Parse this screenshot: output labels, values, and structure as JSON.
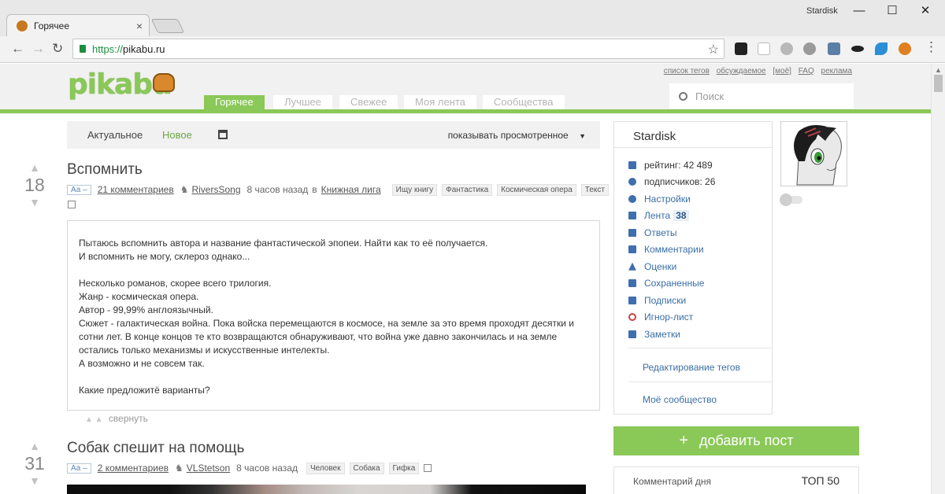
{
  "browser": {
    "tab_title": "Горячее",
    "tab_close": "×",
    "window_user": "Stardisk",
    "win_minimize": "—",
    "win_maximize": "☐",
    "win_close": "✕",
    "url_protocol": "https://",
    "url_host": "pikabu.ru",
    "back": "←",
    "forward": "→",
    "reload": "↻",
    "bookmark_star": "☆"
  },
  "header": {
    "logo": "pikabu",
    "toplinks": [
      "список тегов",
      "обсуждаемое",
      "[моё]",
      "FAQ",
      "реклама"
    ],
    "nav": [
      "Горячее",
      "Лучшее",
      "Свежее",
      "Моя лента",
      "Сообщества"
    ],
    "search_placeholder": "Поиск"
  },
  "filters": {
    "actual": "Актуальное",
    "new": "Новое",
    "show_viewed": "показывать просмотренное",
    "caret": "▼"
  },
  "posts": [
    {
      "rating": "18",
      "title": "Вспомнить",
      "font_toggle": "Аа –",
      "comments": "21 комментариев",
      "author": "RiversSong",
      "time": "8 часов назад",
      "in_word": "в",
      "community": "Книжная лига",
      "tags": [
        "Ищу книгу",
        "Фантастика",
        "Космическая опера",
        "Текст"
      ],
      "body": [
        "Пытаюсь вспомнить автора и название фантастической эпопеи. Найти как то её получается.",
        "И вспомнить не могу, склероз однако...",
        "",
        "Несколько романов, скорее всего трилогия.",
        "Жанр - космическая опера.",
        "Автор - 99,99% англоязычный.",
        "Сюжет - галактическая война. Пока войска перемещаются в космосе, на земле за это время проходят десятки и сотни лет. В конце концов те кто возвращаются обнаруживают, что война уже давно закончилась и на земле остались только механизмы и искусственные интелекты.",
        "А возможно и не совсем так.",
        "",
        "Какие предложитё варианты?"
      ],
      "collapse": "свернуть"
    },
    {
      "rating": "31",
      "title": "Собак спешит на помощь",
      "font_toggle": "Аа –",
      "comments": "2 комментариев",
      "author": "VLStetson",
      "time": "8 часов назад",
      "tags": [
        "Человек",
        "Собака",
        "Гифка"
      ]
    }
  ],
  "sidebar": {
    "username": "Stardisk",
    "items": [
      {
        "label": "рейтинг: 42 489",
        "icon": "chart-icon"
      },
      {
        "label": "подписчиков: 26",
        "icon": "user-icon"
      },
      {
        "label": "Настройки",
        "icon": "gear-icon"
      },
      {
        "label": "Лента",
        "icon": "feed-icon",
        "badge": "38"
      },
      {
        "label": "Ответы",
        "icon": "mail-icon"
      },
      {
        "label": "Комментарии",
        "icon": "comment-icon"
      },
      {
        "label": "Оценки",
        "icon": "vote-icon"
      },
      {
        "label": "Сохраненные",
        "icon": "save-icon"
      },
      {
        "label": "Подписки",
        "icon": "subscriptions-icon"
      },
      {
        "label": "Игнор-лист",
        "icon": "ignore-icon"
      },
      {
        "label": "Заметки",
        "icon": "notes-icon"
      }
    ],
    "edit_tags": "Редактирование тегов",
    "my_community": "Моё сообщество",
    "add_post": "добавить пост",
    "add_plus": "+",
    "comment_of_day": "Комментарий дня",
    "top50": "ТОП 50"
  },
  "colors": {
    "brand_green": "#8ac858",
    "link_blue": "#3a6ea5"
  }
}
